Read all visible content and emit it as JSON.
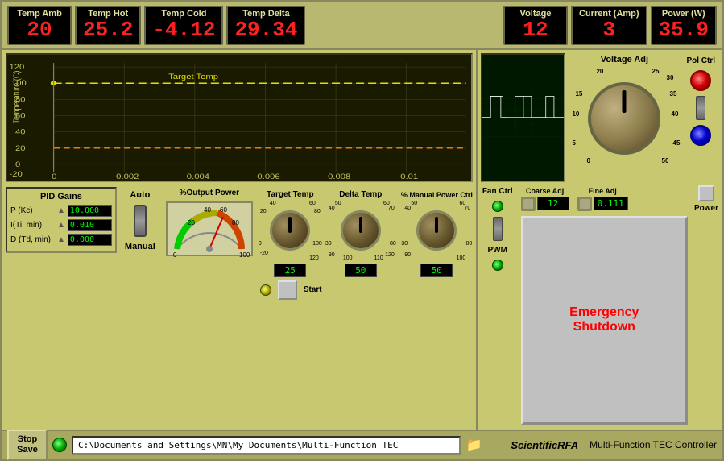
{
  "title": "Multi-Function TEC Controller",
  "metrics": {
    "top_left": [
      {
        "label": "Temp Amb",
        "value": "20"
      },
      {
        "label": "Temp Hot",
        "value": "25.2"
      },
      {
        "label": "Temp Cold",
        "value": "-4.12"
      },
      {
        "label": "Temp Delta",
        "value": "29.34"
      }
    ],
    "top_right": [
      {
        "label": "Voltage",
        "value": "12"
      },
      {
        "label": "Current (Amp)",
        "value": "3"
      },
      {
        "label": "Power (W)",
        "value": "35.9"
      }
    ]
  },
  "pid": {
    "title": "PID Gains",
    "p_label": "P (Kc)",
    "p_value": "10.000",
    "i_label": "I(Ti, min)",
    "i_value": "0.010",
    "d_label": "D (Td, min)",
    "d_value": "0.000"
  },
  "auto_manual": {
    "auto_label": "Auto",
    "manual_label": "Manual"
  },
  "output_power": {
    "title": "%Output Power"
  },
  "knobs": [
    {
      "label": "Target Temp",
      "value": "25",
      "scales": [
        "-20",
        "0",
        "20",
        "40",
        "60",
        "80",
        "100",
        "120"
      ]
    },
    {
      "label": "Delta Temp",
      "value": "50",
      "scales": [
        "30",
        "40",
        "50",
        "60",
        "70",
        "80",
        "90",
        "100",
        "110",
        "120"
      ]
    },
    {
      "label": "% Manual Power Ctrl",
      "value": "50",
      "scales": [
        "30",
        "40",
        "50",
        "60",
        "70",
        "80",
        "90",
        "100"
      ]
    }
  ],
  "voltage_adj": {
    "title": "Voltage  Adj",
    "scales": [
      "5",
      "10",
      "15",
      "20",
      "25",
      "30",
      "35",
      "40",
      "45",
      "50"
    ],
    "coarse_label": "Coarse Adj",
    "coarse_value": "12",
    "fine_label": "Fine Adj",
    "fine_value": "0.111"
  },
  "fan_ctrl": {
    "label": "Fan Ctrl"
  },
  "pwm": {
    "label": "PWM"
  },
  "pol_ctrl": {
    "label": "Pol Ctrl",
    "plus": "+",
    "minus": "-"
  },
  "emergency": {
    "button_label": "Emergency Shutdown"
  },
  "power": {
    "label": "Power"
  },
  "status_bar": {
    "stop_save": "Stop\nSave",
    "path": "C:\\Documents and Settings\\MN\\My Documents\\Multi-Function TEC",
    "brand": "ScientificRFA",
    "description": "Multi-Function TEC Controller"
  },
  "start": {
    "label": "Start"
  }
}
